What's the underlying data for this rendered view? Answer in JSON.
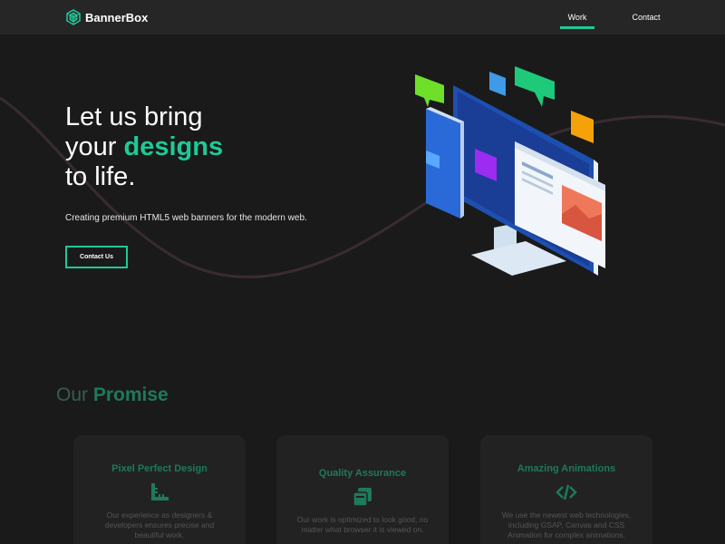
{
  "nav": {
    "brand": "BannerBox",
    "links": [
      {
        "label": "Work",
        "active": true
      },
      {
        "label": "Contact",
        "active": false
      }
    ]
  },
  "hero": {
    "title_line1": "Let us bring",
    "title_line2_prefix": "your ",
    "title_line2_accent": "designs",
    "title_line3": "to life.",
    "subtitle": "Creating premium HTML5 web banners for the modern web.",
    "cta_label": "Contact Us"
  },
  "promise": {
    "title_prefix": "Our ",
    "title_accent": "Promise",
    "cards": [
      {
        "title": "Pixel Perfect Design",
        "icon": "ruler-icon",
        "text": "Our experience as designers & developers ensures precise and beautiful work."
      },
      {
        "title": "Quality Assurance",
        "icon": "copy-icon",
        "text": "Our work is optimized to look good, no matter what browser it is viewed on."
      },
      {
        "title": "Amazing Animations",
        "icon": "code-icon",
        "text": "We use the newest web technologies, including GSAP, Canvas and CSS Animation for complex animations."
      }
    ]
  },
  "colors": {
    "background": "#1a1a1a",
    "navbar": "#262626",
    "accent": "#20c997",
    "accent_dim": "#1e7a59",
    "card": "#222222"
  }
}
